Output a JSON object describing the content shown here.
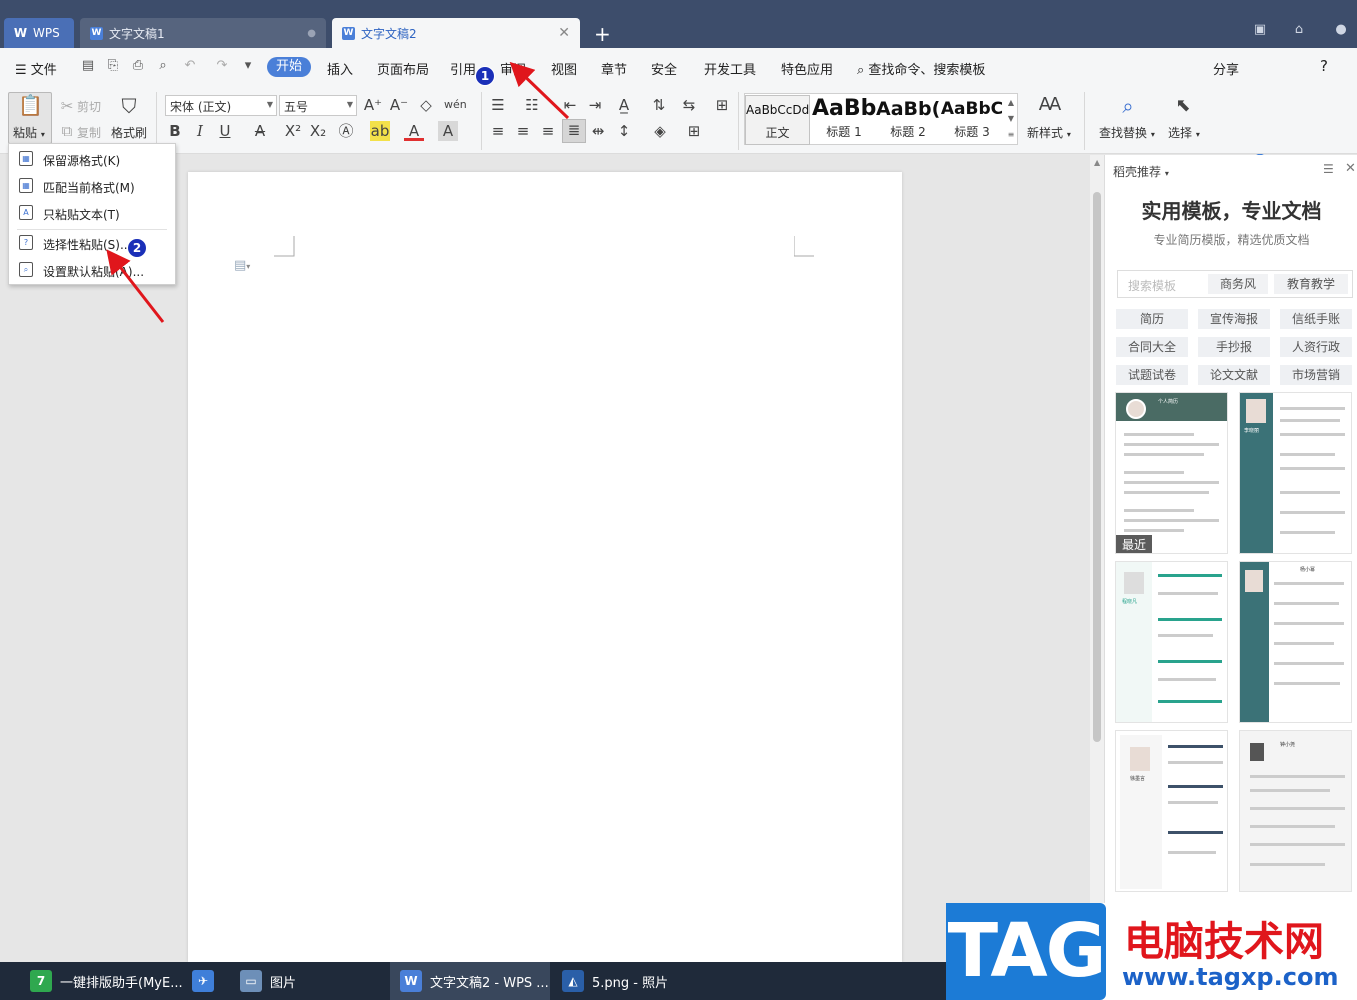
{
  "tabs": [
    {
      "label": "WPS"
    },
    {
      "label": "文字文稿1"
    },
    {
      "label": "文字文稿2"
    }
  ],
  "menu": {
    "file": "文件",
    "items": [
      "开始",
      "插入",
      "页面布局",
      "引用",
      "审阅",
      "视图",
      "章节",
      "安全",
      "开发工具",
      "特色应用"
    ],
    "search": "查找命令、搜索模板",
    "share": "分享",
    "help": "?"
  },
  "ribbon": {
    "paste": "粘贴",
    "cut": "剪切",
    "copy": "复制",
    "format_painter": "格式刷",
    "font": "宋体 (正文)",
    "size": "五号",
    "styles": [
      {
        "sample": "AaBbCcDd",
        "label": "正文"
      },
      {
        "sample": "AaBb",
        "label": "标题 1"
      },
      {
        "sample": "AaBb(",
        "label": "标题 2"
      },
      {
        "sample": "AaBbC",
        "label": "标题 3"
      }
    ],
    "new_style": "新样式",
    "find_replace": "查找替换",
    "select": "选择"
  },
  "paste_menu": {
    "items": [
      "保留源格式(K)",
      "匹配当前格式(M)",
      "只粘贴文本(T)",
      "选择性粘贴(S)...",
      "设置默认粘贴(A)..."
    ]
  },
  "right_panel": {
    "header": "稻壳推荐",
    "title": "实用模板，专业文档",
    "subtitle": "专业简历模版，精选优质文档",
    "search_placeholder": "搜索模板",
    "filters": [
      "商务风",
      "教育教学"
    ],
    "chips": [
      "简历",
      "宣传海报",
      "信纸手账",
      "合同大全",
      "手抄报",
      "人资行政",
      "试题试卷",
      "论文文献",
      "市场营销"
    ],
    "recent_label": "最近",
    "thumb_names": [
      "个人简历",
      "李晓丽",
      "程晓凡",
      "杨小幂",
      "徐墨言",
      "钟小尧"
    ]
  },
  "taskbar": [
    {
      "label": "一键排版助手(MyE..."
    },
    {
      "label": ""
    },
    {
      "label": "图片"
    },
    {
      "label": "文字文稿2 - WPS ..."
    },
    {
      "label": "5.png - 照片"
    }
  ],
  "watermark": {
    "tag": "TAG",
    "cn": "电脑技术网",
    "url": "www.tagxp.com"
  },
  "annotations": [
    "1",
    "2"
  ],
  "colors": {
    "accent": "#4a7fd8",
    "titlebar": "#3d4d6b",
    "arrow": "#e0161c",
    "badge": "#1a2fb8"
  }
}
